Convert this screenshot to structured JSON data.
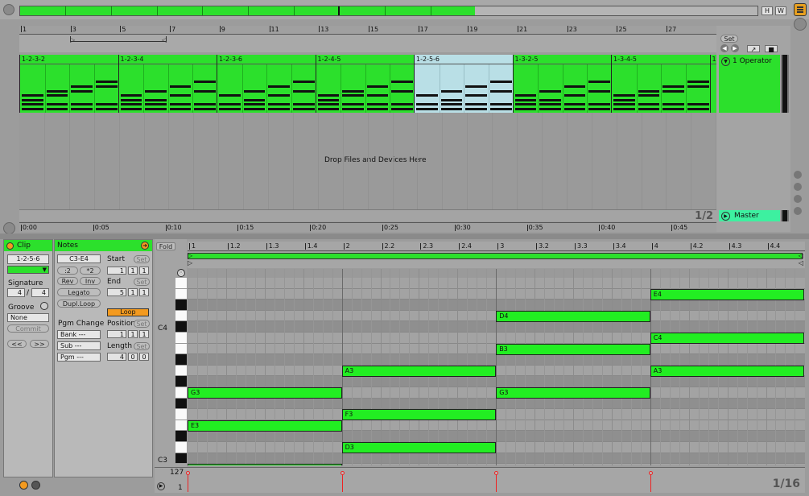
{
  "overview": {
    "h_button": "H",
    "w_button": "W"
  },
  "arrangement": {
    "bar_numbers": [
      "1",
      "3",
      "5",
      "7",
      "9",
      "11",
      "13",
      "15",
      "17",
      "19",
      "21",
      "23",
      "25",
      "27"
    ],
    "time_labels": [
      "0:00",
      "0:05",
      "0:10",
      "0:15",
      "0:20",
      "0:25",
      "0:30",
      "0:35",
      "0:40",
      "0:45"
    ],
    "clips": [
      {
        "name": "1-2-3-2"
      },
      {
        "name": "1-2-3-4"
      },
      {
        "name": "1-2-3-6"
      },
      {
        "name": "1-2-4-5"
      },
      {
        "name": "1-2-5-6"
      },
      {
        "name": "1-3-2-5"
      },
      {
        "name": "1-3-4-5"
      },
      {
        "name": "1"
      }
    ],
    "drop_text": "Drop Files and Devices Here",
    "page_indicator": "1/2",
    "set_button": "Set",
    "track_name": "1 Operator",
    "master_name": "Master"
  },
  "clip_panel": {
    "header": "Clip",
    "clip_name": "1-2-5-6",
    "signature_label": "Signature",
    "sig_num": "4",
    "sig_sep": "/",
    "sig_den": "4",
    "groove_label": "Groove",
    "groove_value": "None",
    "commit": "Commit",
    "nudge_back": "<<",
    "nudge_fwd": ">>"
  },
  "notes_panel": {
    "header": "Notes",
    "range": "C3-E4",
    "half": ":2",
    "double": "*2",
    "rev": "Rev",
    "inv": "Inv",
    "legato": "Legato",
    "dupl_loop": "Dupl.Loop",
    "pgm_change": "Pgm Change",
    "bank": "Bank ---",
    "sub": "Sub ---",
    "pgm": "Pgm ---",
    "start_label": "Start",
    "start_vals": [
      "1",
      "1",
      "1"
    ],
    "end_label": "End",
    "end_vals": [
      "5",
      "1",
      "1"
    ],
    "loop": "Loop",
    "position_label": "Position",
    "position_vals": [
      "1",
      "1",
      "1"
    ],
    "length_label": "Length",
    "length_vals": [
      "4",
      "0",
      "0"
    ],
    "set": "Set"
  },
  "midi_editor": {
    "fold": "Fold",
    "ruler": [
      "1",
      "1.2",
      "1.3",
      "1.4",
      "2",
      "2.2",
      "2.3",
      "2.4",
      "3",
      "3.2",
      "3.3",
      "3.4",
      "4",
      "4.2",
      "4.3",
      "4.4"
    ],
    "octave_labels": {
      "c4": "C4",
      "c3": "C3"
    },
    "notes": [
      {
        "name": "E4",
        "bar_start": 4,
        "bar_len": 1
      },
      {
        "name": "D4",
        "bar_start": 3,
        "bar_len": 1
      },
      {
        "name": "C4",
        "bar_start": 4,
        "bar_len": 1
      },
      {
        "name": "B3",
        "bar_start": 3,
        "bar_len": 1
      },
      {
        "name": "A3",
        "bar_start": 2,
        "bar_len": 1
      },
      {
        "name": "A3",
        "bar_start": 4,
        "bar_len": 1
      },
      {
        "name": "G3",
        "bar_start": 1,
        "bar_len": 1
      },
      {
        "name": "G3",
        "bar_start": 3,
        "bar_len": 1
      },
      {
        "name": "F3",
        "bar_start": 2,
        "bar_len": 1
      },
      {
        "name": "E3",
        "bar_start": 1,
        "bar_len": 1
      },
      {
        "name": "D3",
        "bar_start": 2,
        "bar_len": 1
      },
      {
        "name": "C3",
        "bar_start": 1,
        "bar_len": 1
      }
    ],
    "velocity_max": "127",
    "velocity_min": "1",
    "grid": "1/16"
  }
}
